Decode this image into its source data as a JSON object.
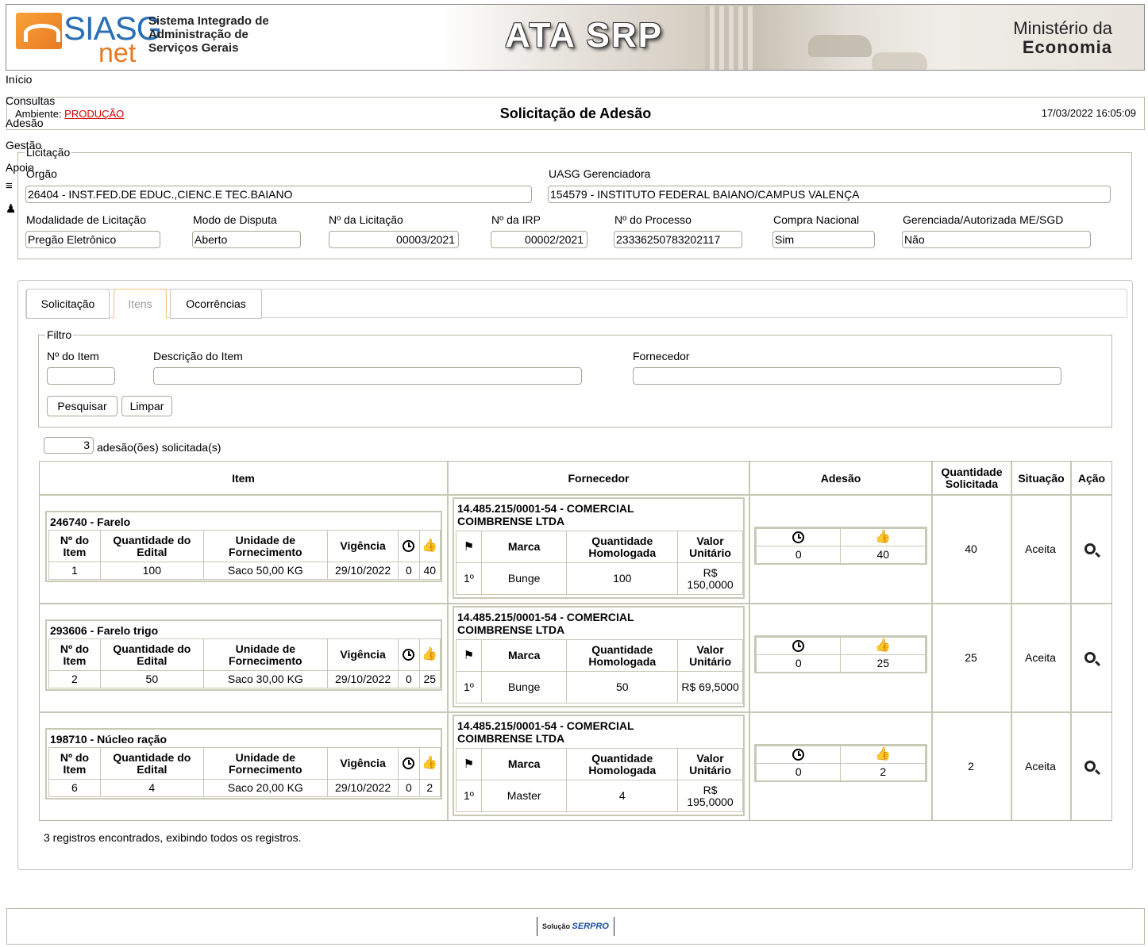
{
  "banner": {
    "logo_text": "SIASG",
    "logo_sub": "net",
    "system_name_1": "Sistema Integrado de",
    "system_name_2": "Administração de",
    "system_name_3": "Serviços Gerais",
    "app_title": "ATA SRP",
    "ministry_1": "Ministério da",
    "ministry_2": "Economia"
  },
  "nav": [
    "Início",
    "Consultas",
    "Adesão",
    "Gestão",
    "Apoio"
  ],
  "header": {
    "env_label": "Ambiente:",
    "env_value": "PRODUÇÃO",
    "title": "Solicitação de Adesão",
    "datetime": "17/03/2022 16:05:09"
  },
  "licitacao": {
    "legend": "Licitação",
    "orgao_label": "Órgão",
    "orgao_value": "26404 - INST.FED.DE EDUC.,CIENC.E TEC.BAIANO",
    "uasg_label": "UASG Gerenciadora",
    "uasg_value": "154579 - INSTITUTO FEDERAL BAIANO/CAMPUS VALENÇA",
    "modalidade_label": "Modalidade de Licitação",
    "modalidade_value": "Pregão Eletrônico",
    "modo_label": "Modo de Disputa",
    "modo_value": "Aberto",
    "numero_label": "Nº da Licitação",
    "numero_value": "00003/2021",
    "irp_label": "Nº da IRP",
    "irp_value": "00002/2021",
    "processo_label": "Nº do Processo",
    "processo_value": "23336250783202117",
    "compra_label": "Compra Nacional",
    "compra_value": "Sim",
    "gerenciada_label": "Gerenciada/Autorizada ME/SGD",
    "gerenciada_value": "Não"
  },
  "tabs": [
    "Solicitação",
    "Itens",
    "Ocorrências"
  ],
  "filtro": {
    "legend": "Filtro",
    "item_label": "Nº do Item",
    "item_value": "",
    "descricao_label": "Descrição do Item",
    "descricao_value": "",
    "fornecedor_label": "Fornecedor",
    "fornecedor_value": "",
    "pesquisar": "Pesquisar",
    "limpar": "Limpar"
  },
  "count": {
    "value": "3",
    "suffix": "adesão(ões) solicitada(s)"
  },
  "table": {
    "headers": [
      "Item",
      "Fornecedor",
      "Adesão",
      "Quantidade Solicitada",
      "Situação",
      "Ação"
    ],
    "item_headers": [
      "Nº do Item",
      "Quantidade do Edital",
      "Unidade de Fornecimento",
      "Vigência"
    ],
    "forn_headers": [
      "Marca",
      "Quantidade Homologada",
      "Valor Unitário"
    ],
    "rows": [
      {
        "item_title": "246740 - Farelo",
        "num": "1",
        "qtd_edital": "100",
        "unidade": "Saco 50,00 KG",
        "vigencia": "29/10/2022",
        "clock": "0",
        "thumb": "40",
        "fornecedor": "14.485.215/0001-54 - COMERCIAL COIMBRENSE LTDA",
        "pos": "1º",
        "marca": "Bunge",
        "qtd_homologada": "100",
        "valor": "R$ 150,0000",
        "adesao_clock": "0",
        "adesao_thumb": "40",
        "qtd_solicitada": "40",
        "situacao": "Aceita"
      },
      {
        "item_title": "293606 - Farelo trigo",
        "num": "2",
        "qtd_edital": "50",
        "unidade": "Saco 30,00 KG",
        "vigencia": "29/10/2022",
        "clock": "0",
        "thumb": "25",
        "fornecedor": "14.485.215/0001-54 - COMERCIAL COIMBRENSE LTDA",
        "pos": "1º",
        "marca": "Bunge",
        "qtd_homologada": "50",
        "valor": "R$ 69,5000",
        "adesao_clock": "0",
        "adesao_thumb": "25",
        "qtd_solicitada": "25",
        "situacao": "Aceita"
      },
      {
        "item_title": "198710 - Núcleo ração",
        "num": "6",
        "qtd_edital": "4",
        "unidade": "Saco 20,00 KG",
        "vigencia": "29/10/2022",
        "clock": "0",
        "thumb": "2",
        "fornecedor": "14.485.215/0001-54 - COMERCIAL COIMBRENSE LTDA",
        "pos": "1º",
        "marca": "Master",
        "qtd_homologada": "4",
        "valor": "R$ 195,0000",
        "adesao_clock": "0",
        "adesao_thumb": "2",
        "qtd_solicitada": "2",
        "situacao": "Aceita"
      }
    ]
  },
  "footer_records": "3 registros encontrados, exibindo todos os registros.",
  "footer_logo": {
    "prefix": "Solução",
    "brand": "SERPRO"
  }
}
